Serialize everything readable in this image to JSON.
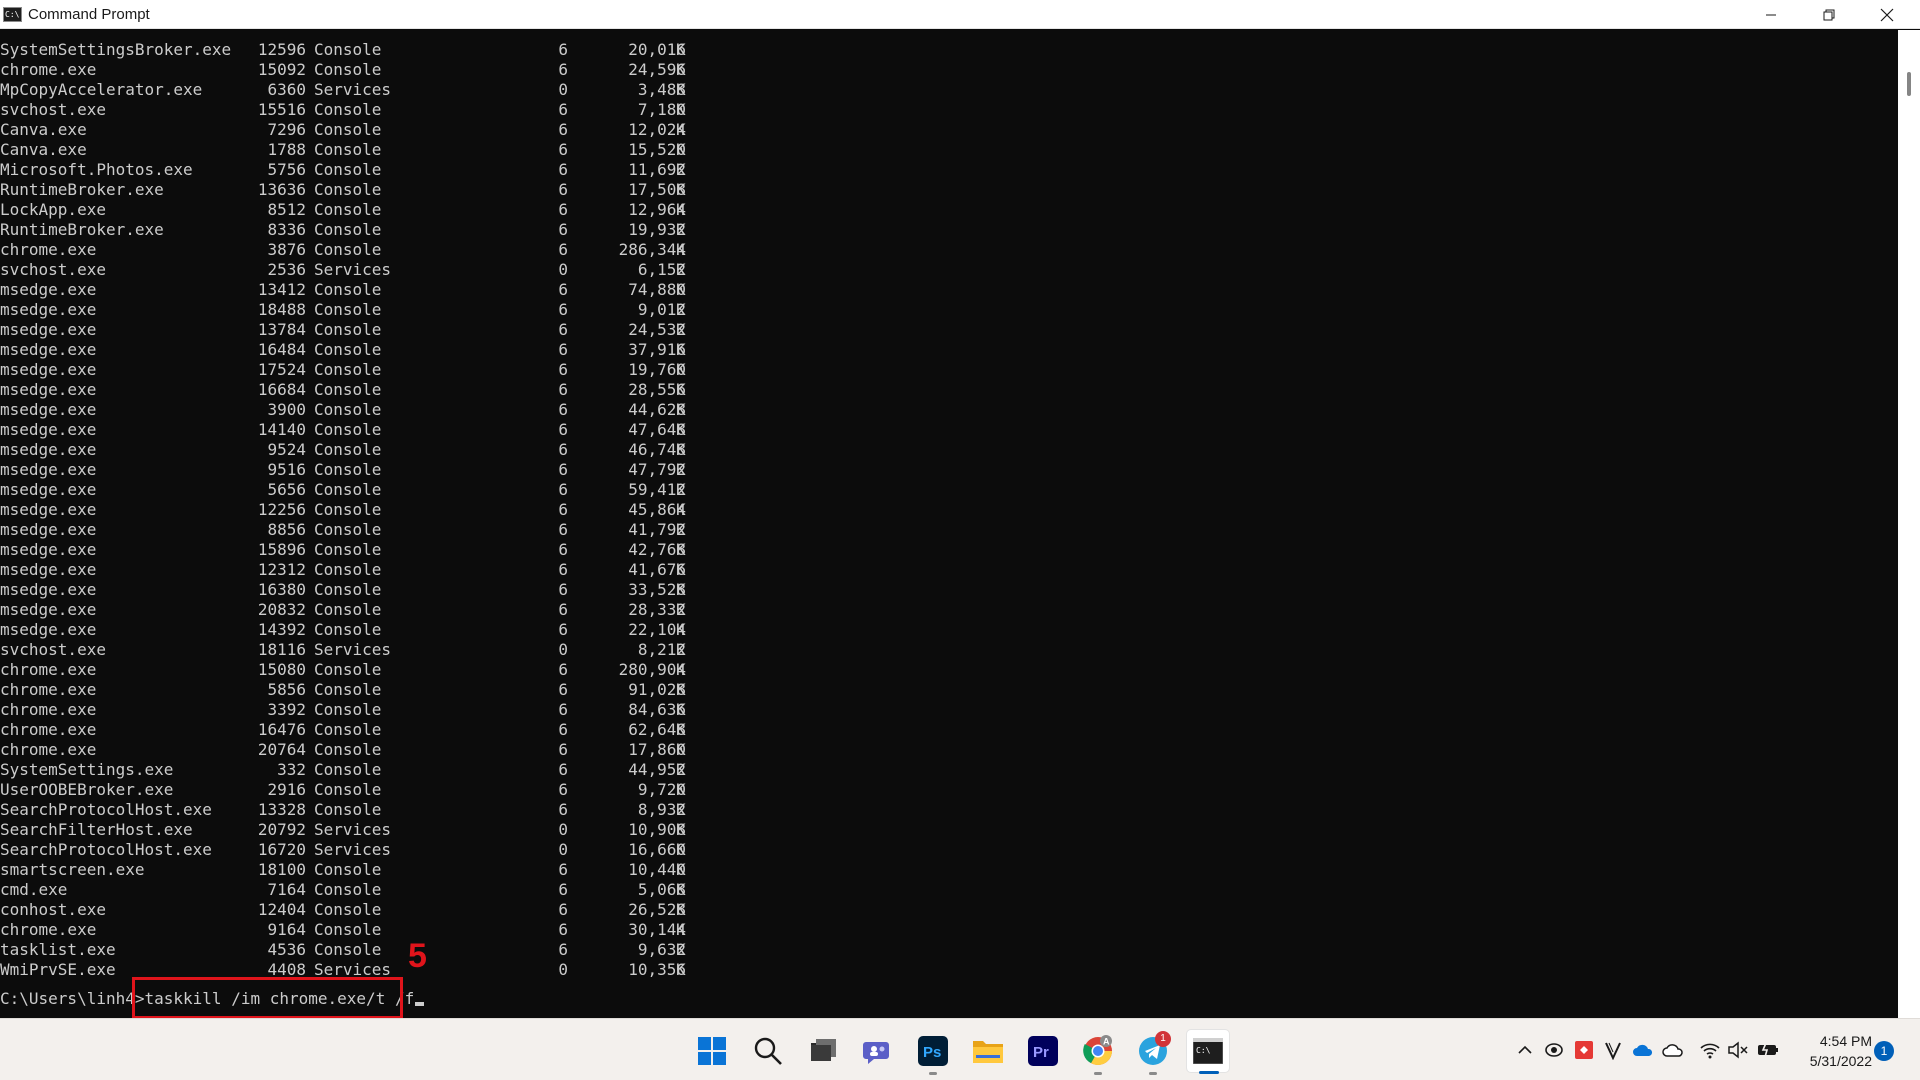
{
  "window": {
    "title": "Command Prompt",
    "icon_text": "C:\\"
  },
  "console": {
    "processes": [
      {
        "name": "SystemSettingsBroker.exe",
        "pid": "12596",
        "session": "Console",
        "num": "6",
        "mem": "20,016",
        "unit": "K"
      },
      {
        "name": "chrome.exe",
        "pid": "15092",
        "session": "Console",
        "num": "6",
        "mem": "24,596",
        "unit": "K"
      },
      {
        "name": "MpCopyAccelerator.exe",
        "pid": "6360",
        "session": "Services",
        "num": "0",
        "mem": "3,488",
        "unit": "K"
      },
      {
        "name": "svchost.exe",
        "pid": "15516",
        "session": "Console",
        "num": "6",
        "mem": "7,180",
        "unit": "K"
      },
      {
        "name": "Canva.exe",
        "pid": "7296",
        "session": "Console",
        "num": "6",
        "mem": "12,024",
        "unit": "K"
      },
      {
        "name": "Canva.exe",
        "pid": "1788",
        "session": "Console",
        "num": "6",
        "mem": "15,520",
        "unit": "K"
      },
      {
        "name": "Microsoft.Photos.exe",
        "pid": "5756",
        "session": "Console",
        "num": "6",
        "mem": "11,692",
        "unit": "K"
      },
      {
        "name": "RuntimeBroker.exe",
        "pid": "13636",
        "session": "Console",
        "num": "6",
        "mem": "17,508",
        "unit": "K"
      },
      {
        "name": "LockApp.exe",
        "pid": "8512",
        "session": "Console",
        "num": "6",
        "mem": "12,964",
        "unit": "K"
      },
      {
        "name": "RuntimeBroker.exe",
        "pid": "8336",
        "session": "Console",
        "num": "6",
        "mem": "19,932",
        "unit": "K"
      },
      {
        "name": "chrome.exe",
        "pid": "3876",
        "session": "Console",
        "num": "6",
        "mem": "286,344",
        "unit": "K"
      },
      {
        "name": "svchost.exe",
        "pid": "2536",
        "session": "Services",
        "num": "0",
        "mem": "6,152",
        "unit": "K"
      },
      {
        "name": "msedge.exe",
        "pid": "13412",
        "session": "Console",
        "num": "6",
        "mem": "74,880",
        "unit": "K"
      },
      {
        "name": "msedge.exe",
        "pid": "18488",
        "session": "Console",
        "num": "6",
        "mem": "9,012",
        "unit": "K"
      },
      {
        "name": "msedge.exe",
        "pid": "13784",
        "session": "Console",
        "num": "6",
        "mem": "24,532",
        "unit": "K"
      },
      {
        "name": "msedge.exe",
        "pid": "16484",
        "session": "Console",
        "num": "6",
        "mem": "37,916",
        "unit": "K"
      },
      {
        "name": "msedge.exe",
        "pid": "17524",
        "session": "Console",
        "num": "6",
        "mem": "19,760",
        "unit": "K"
      },
      {
        "name": "msedge.exe",
        "pid": "16684",
        "session": "Console",
        "num": "6",
        "mem": "28,556",
        "unit": "K"
      },
      {
        "name": "msedge.exe",
        "pid": "3900",
        "session": "Console",
        "num": "6",
        "mem": "44,628",
        "unit": "K"
      },
      {
        "name": "msedge.exe",
        "pid": "14140",
        "session": "Console",
        "num": "6",
        "mem": "47,648",
        "unit": "K"
      },
      {
        "name": "msedge.exe",
        "pid": "9524",
        "session": "Console",
        "num": "6",
        "mem": "46,748",
        "unit": "K"
      },
      {
        "name": "msedge.exe",
        "pid": "9516",
        "session": "Console",
        "num": "6",
        "mem": "47,792",
        "unit": "K"
      },
      {
        "name": "msedge.exe",
        "pid": "5656",
        "session": "Console",
        "num": "6",
        "mem": "59,412",
        "unit": "K"
      },
      {
        "name": "msedge.exe",
        "pid": "12256",
        "session": "Console",
        "num": "6",
        "mem": "45,864",
        "unit": "K"
      },
      {
        "name": "msedge.exe",
        "pid": "8856",
        "session": "Console",
        "num": "6",
        "mem": "41,792",
        "unit": "K"
      },
      {
        "name": "msedge.exe",
        "pid": "15896",
        "session": "Console",
        "num": "6",
        "mem": "42,768",
        "unit": "K"
      },
      {
        "name": "msedge.exe",
        "pid": "12312",
        "session": "Console",
        "num": "6",
        "mem": "41,676",
        "unit": "K"
      },
      {
        "name": "msedge.exe",
        "pid": "16380",
        "session": "Console",
        "num": "6",
        "mem": "33,528",
        "unit": "K"
      },
      {
        "name": "msedge.exe",
        "pid": "20832",
        "session": "Console",
        "num": "6",
        "mem": "28,332",
        "unit": "K"
      },
      {
        "name": "msedge.exe",
        "pid": "14392",
        "session": "Console",
        "num": "6",
        "mem": "22,104",
        "unit": "K"
      },
      {
        "name": "svchost.exe",
        "pid": "18116",
        "session": "Services",
        "num": "0",
        "mem": "8,212",
        "unit": "K"
      },
      {
        "name": "chrome.exe",
        "pid": "15080",
        "session": "Console",
        "num": "6",
        "mem": "280,904",
        "unit": "K"
      },
      {
        "name": "chrome.exe",
        "pid": "5856",
        "session": "Console",
        "num": "6",
        "mem": "91,028",
        "unit": "K"
      },
      {
        "name": "chrome.exe",
        "pid": "3392",
        "session": "Console",
        "num": "6",
        "mem": "84,636",
        "unit": "K"
      },
      {
        "name": "chrome.exe",
        "pid": "16476",
        "session": "Console",
        "num": "6",
        "mem": "62,648",
        "unit": "K"
      },
      {
        "name": "chrome.exe",
        "pid": "20764",
        "session": "Console",
        "num": "6",
        "mem": "17,860",
        "unit": "K"
      },
      {
        "name": "SystemSettings.exe",
        "pid": "332",
        "session": "Console",
        "num": "6",
        "mem": "44,952",
        "unit": "K"
      },
      {
        "name": "UserOOBEBroker.exe",
        "pid": "2916",
        "session": "Console",
        "num": "6",
        "mem": "9,720",
        "unit": "K"
      },
      {
        "name": "SearchProtocolHost.exe",
        "pid": "13328",
        "session": "Console",
        "num": "6",
        "mem": "8,932",
        "unit": "K"
      },
      {
        "name": "SearchFilterHost.exe",
        "pid": "20792",
        "session": "Services",
        "num": "0",
        "mem": "10,908",
        "unit": "K"
      },
      {
        "name": "SearchProtocolHost.exe",
        "pid": "16720",
        "session": "Services",
        "num": "0",
        "mem": "16,660",
        "unit": "K"
      },
      {
        "name": "smartscreen.exe",
        "pid": "18100",
        "session": "Console",
        "num": "6",
        "mem": "10,440",
        "unit": "K"
      },
      {
        "name": "cmd.exe",
        "pid": "7164",
        "session": "Console",
        "num": "6",
        "mem": "5,068",
        "unit": "K"
      },
      {
        "name": "conhost.exe",
        "pid": "12404",
        "session": "Console",
        "num": "6",
        "mem": "26,528",
        "unit": "K"
      },
      {
        "name": "chrome.exe",
        "pid": "9164",
        "session": "Console",
        "num": "6",
        "mem": "30,144",
        "unit": "K"
      },
      {
        "name": "tasklist.exe",
        "pid": "4536",
        "session": "Console",
        "num": "6",
        "mem": "9,632",
        "unit": "K"
      },
      {
        "name": "WmiPrvSE.exe",
        "pid": "4408",
        "session": "Services",
        "num": "0",
        "mem": "10,356",
        "unit": "K"
      }
    ],
    "prompt": "C:\\Users\\linh4>",
    "command": "taskkill /im chrome.exe/t /f",
    "step_label": "5"
  },
  "taskbar": {
    "apps": [
      {
        "name": "start-button",
        "icon": "windows-logo"
      },
      {
        "name": "search-button",
        "icon": "search-icon"
      },
      {
        "name": "task-view-button",
        "icon": "task-view-icon"
      },
      {
        "name": "teams-chat-button",
        "icon": "teams-chat-icon"
      },
      {
        "name": "photoshop-app",
        "icon": "photoshop-icon",
        "label": "Ps"
      },
      {
        "name": "file-explorer-app",
        "icon": "folder-icon"
      },
      {
        "name": "premiere-app",
        "icon": "premiere-icon",
        "label": "Pr"
      },
      {
        "name": "chrome-app",
        "icon": "chrome-icon"
      },
      {
        "name": "telegram-app",
        "icon": "telegram-icon",
        "badge": "1"
      },
      {
        "name": "command-prompt-app",
        "icon": "terminal-icon"
      }
    ],
    "clock": {
      "time": "4:54 PM",
      "date": "5/31/2022"
    },
    "notification_count": "1"
  }
}
